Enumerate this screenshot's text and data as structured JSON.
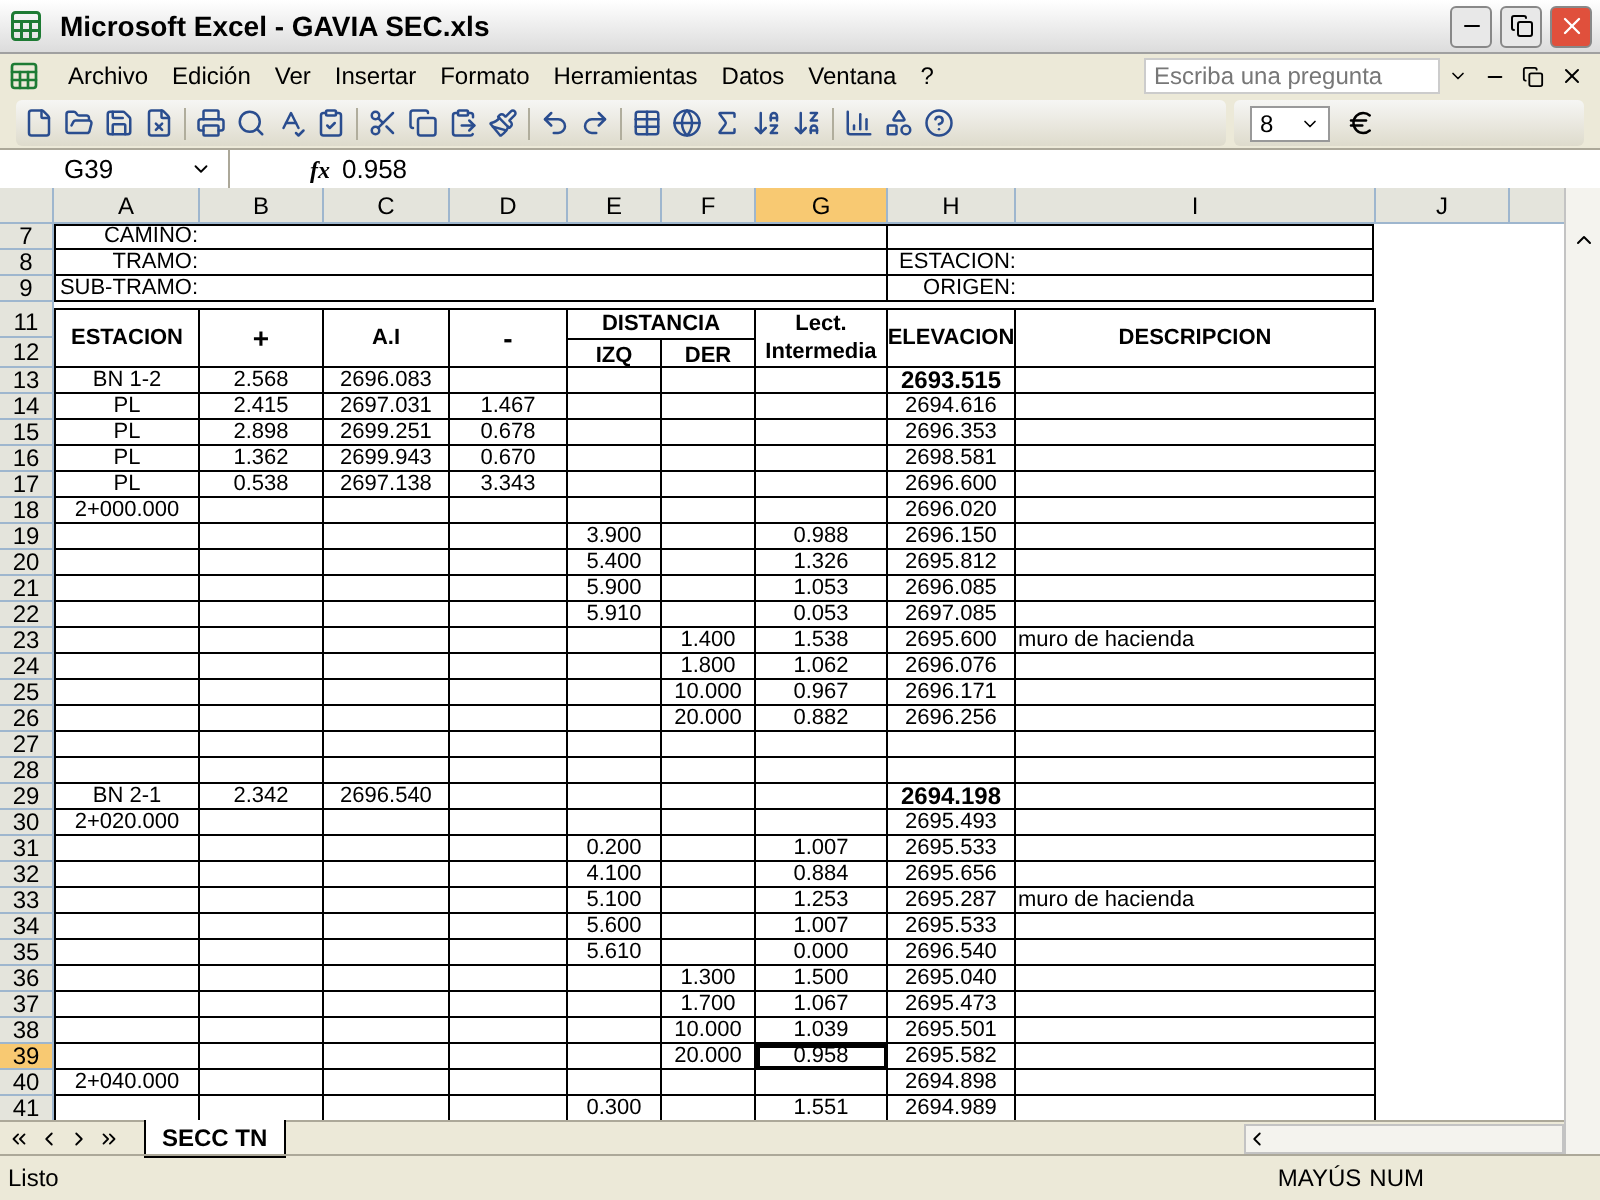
{
  "window": {
    "title": "Microsoft Excel - GAVIA SEC.xls"
  },
  "menu": [
    "Archivo",
    "Edición",
    "Ver",
    "Insertar",
    "Formato",
    "Herramientas",
    "Datos",
    "Ventana",
    "?"
  ],
  "help_search": {
    "placeholder": "Escriba una pregunta"
  },
  "toolbar": {
    "font_size": "8"
  },
  "formula_bar": {
    "name_box": "G39",
    "function_label": "fx",
    "value": "0.958"
  },
  "columns": [
    {
      "label": "A",
      "selected": false
    },
    {
      "label": "B",
      "selected": false
    },
    {
      "label": "C",
      "selected": false
    },
    {
      "label": "D",
      "selected": false
    },
    {
      "label": "E",
      "selected": false
    },
    {
      "label": "F",
      "selected": false
    },
    {
      "label": "G",
      "selected": true
    },
    {
      "label": "H",
      "selected": false
    },
    {
      "label": "I",
      "selected": false
    },
    {
      "label": "J",
      "selected": false
    }
  ],
  "info_rows": [
    {
      "number": "7",
      "label": "CAMINO:"
    },
    {
      "number": "8",
      "label": "TRAMO:",
      "right_label": "ESTACION:"
    },
    {
      "number": "9",
      "label": "SUB-TRAMO:",
      "right_label": "ORIGEN:"
    }
  ],
  "header": {
    "row_numbers": [
      "11",
      "12"
    ],
    "estacion": "ESTACION",
    "plus": "+",
    "ai": "A.I",
    "minus": "-",
    "distancia": "DISTANCIA",
    "izq": "IZQ",
    "der": "DER",
    "lect": "Lect. Intermedia",
    "elevacion": "ELEVACION",
    "descripcion": "DESCRIPCION"
  },
  "rows": [
    {
      "number": "13",
      "selected": false,
      "elevation_bold": true,
      "cells": {
        "A": "BN 1-2",
        "B": "2.568",
        "C": "2696.083",
        "H": "2693.515"
      }
    },
    {
      "number": "14",
      "selected": false,
      "elevation_bold": false,
      "cells": {
        "A": "PL",
        "B": "2.415",
        "C": "2697.031",
        "D": "1.467",
        "H": "2694.616"
      }
    },
    {
      "number": "15",
      "selected": false,
      "elevation_bold": false,
      "cells": {
        "A": "PL",
        "B": "2.898",
        "C": "2699.251",
        "D": "0.678",
        "H": "2696.353"
      }
    },
    {
      "number": "16",
      "selected": false,
      "elevation_bold": false,
      "cells": {
        "A": "PL",
        "B": "1.362",
        "C": "2699.943",
        "D": "0.670",
        "H": "2698.581"
      }
    },
    {
      "number": "17",
      "selected": false,
      "elevation_bold": false,
      "cells": {
        "A": "PL",
        "B": "0.538",
        "C": "2697.138",
        "D": "3.343",
        "H": "2696.600"
      }
    },
    {
      "number": "18",
      "selected": false,
      "elevation_bold": false,
      "cells": {
        "A": "2+000.000",
        "H": "2696.020"
      }
    },
    {
      "number": "19",
      "selected": false,
      "elevation_bold": false,
      "cells": {
        "E": "3.900",
        "G": "0.988",
        "H": "2696.150"
      }
    },
    {
      "number": "20",
      "selected": false,
      "elevation_bold": false,
      "cells": {
        "E": "5.400",
        "G": "1.326",
        "H": "2695.812"
      }
    },
    {
      "number": "21",
      "selected": false,
      "elevation_bold": false,
      "cells": {
        "E": "5.900",
        "G": "1.053",
        "H": "2696.085"
      }
    },
    {
      "number": "22",
      "selected": false,
      "elevation_bold": false,
      "cells": {
        "E": "5.910",
        "G": "0.053",
        "H": "2697.085"
      }
    },
    {
      "number": "23",
      "selected": false,
      "elevation_bold": false,
      "cells": {
        "F": "1.400",
        "G": "1.538",
        "H": "2695.600",
        "I": "muro de hacienda"
      }
    },
    {
      "number": "24",
      "selected": false,
      "elevation_bold": false,
      "cells": {
        "F": "1.800",
        "G": "1.062",
        "H": "2696.076"
      }
    },
    {
      "number": "25",
      "selected": false,
      "elevation_bold": false,
      "cells": {
        "F": "10.000",
        "G": "0.967",
        "H": "2696.171"
      }
    },
    {
      "number": "26",
      "selected": false,
      "elevation_bold": false,
      "cells": {
        "F": "20.000",
        "G": "0.882",
        "H": "2696.256"
      }
    },
    {
      "number": "27",
      "selected": false
    },
    {
      "number": "28",
      "selected": false
    },
    {
      "number": "29",
      "selected": false,
      "elevation_bold": true,
      "cells": {
        "A": "BN 2-1",
        "B": "2.342",
        "C": "2696.540",
        "H": "2694.198"
      }
    },
    {
      "number": "30",
      "selected": false,
      "elevation_bold": false,
      "cells": {
        "A": "2+020.000",
        "H": "2695.493"
      }
    },
    {
      "number": "31",
      "selected": false,
      "elevation_bold": false,
      "cells": {
        "E": "0.200",
        "G": "1.007",
        "H": "2695.533"
      }
    },
    {
      "number": "32",
      "selected": false,
      "elevation_bold": false,
      "cells": {
        "E": "4.100",
        "G": "0.884",
        "H": "2695.656"
      }
    },
    {
      "number": "33",
      "selected": false,
      "elevation_bold": false,
      "cells": {
        "E": "5.100",
        "G": "1.253",
        "H": "2695.287",
        "I": "muro de hacienda"
      }
    },
    {
      "number": "34",
      "selected": false,
      "elevation_bold": false,
      "cells": {
        "E": "5.600",
        "G": "1.007",
        "H": "2695.533"
      }
    },
    {
      "number": "35",
      "selected": false,
      "elevation_bold": false,
      "cells": {
        "E": "5.610",
        "G": "0.000",
        "H": "2696.540"
      }
    },
    {
      "number": "36",
      "selected": false,
      "elevation_bold": false,
      "cells": {
        "F": "1.300",
        "G": "1.500",
        "H": "2695.040"
      }
    },
    {
      "number": "37",
      "selected": false,
      "elevation_bold": false,
      "cells": {
        "F": "1.700",
        "G": "1.067",
        "H": "2695.473"
      }
    },
    {
      "number": "38",
      "selected": false,
      "elevation_bold": false,
      "cells": {
        "F": "10.000",
        "G": "1.039",
        "H": "2695.501"
      }
    },
    {
      "number": "39",
      "selected": true,
      "elevation_bold": false,
      "cells": {
        "F": "20.000",
        "G": "0.958",
        "H": "2695.582"
      }
    },
    {
      "number": "40",
      "selected": false,
      "elevation_bold": false,
      "cells": {
        "A": "2+040.000",
        "H": "2694.898"
      }
    },
    {
      "number": "41",
      "selected": false,
      "elevation_bold": false,
      "cells": {
        "E": "0.300",
        "G": "1.551",
        "H": "2694.989"
      }
    }
  ],
  "sheet_tabs": [
    {
      "label": "SECC TN",
      "selected": true
    }
  ],
  "status_bar": {
    "text": "Listo",
    "indicators": [
      "MAYÚS",
      "NUM"
    ]
  }
}
